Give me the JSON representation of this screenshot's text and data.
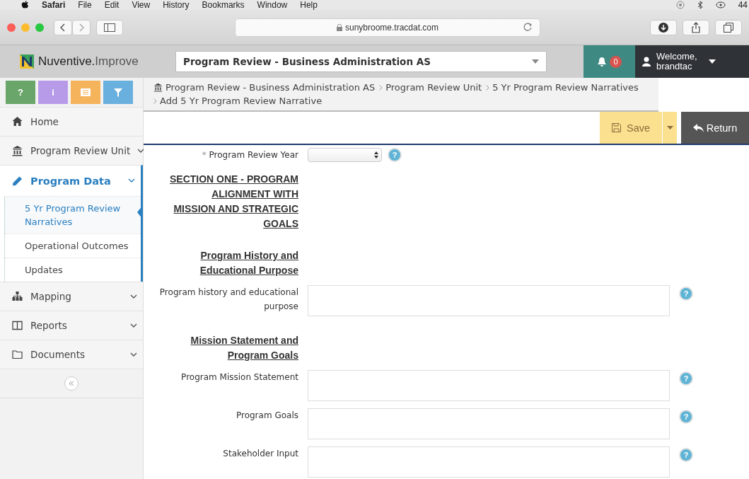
{
  "menu_bar": {
    "items": [
      "Safari",
      "File",
      "Edit",
      "View",
      "History",
      "Bookmarks",
      "Window",
      "Help"
    ],
    "battery": "44"
  },
  "browser": {
    "url": "sunybroome.tracdat.com"
  },
  "header": {
    "brand": "Nuventive",
    "brand_dot": ".",
    "product": "Improve",
    "context": "Program Review - Business Administration AS",
    "notifications": "0",
    "welcome": "Welcome,",
    "user": "brandtac"
  },
  "tools": [
    {
      "label": "?",
      "color": "#6aa56a"
    },
    {
      "label": "i",
      "color": "#b79be8"
    },
    {
      "color": "#f5b35c"
    },
    {
      "color": "#6ab0de"
    }
  ],
  "nav": [
    {
      "label": "Home",
      "expandable": false,
      "selected": false
    },
    {
      "label": "Program Review Unit",
      "expandable": true,
      "selected": false
    },
    {
      "label": "Program Data",
      "expandable": true,
      "selected": true,
      "children": [
        {
          "label": "5 Yr Program Review Narratives",
          "selected": true
        },
        {
          "label": "Operational Outcomes",
          "selected": false
        },
        {
          "label": "Updates",
          "selected": false
        }
      ]
    },
    {
      "label": "Mapping",
      "expandable": true,
      "selected": false
    },
    {
      "label": "Reports",
      "expandable": true,
      "selected": false
    },
    {
      "label": "Documents",
      "expandable": true,
      "selected": false
    }
  ],
  "breadcrumb": [
    "Program Review - Business Administration AS",
    "Program Review Unit",
    "5 Yr Program Review Narratives",
    "Add 5 Yr Program Review Narrative"
  ],
  "actions": {
    "save": "Save",
    "return": "Return"
  },
  "form": [
    {
      "kind": "select",
      "label": "Program Review Year",
      "required_mark": "*",
      "help": "?"
    },
    {
      "kind": "heading",
      "label": "SECTION ONE - PROGRAM ALIGNMENT WITH MISSION AND STRATEGIC GOALS"
    },
    {
      "kind": "heading",
      "label": "Program History and Educational Purpose"
    },
    {
      "kind": "textarea",
      "label": "Program history and educational purpose",
      "help": "?"
    },
    {
      "kind": "heading",
      "label": "Mission Statement and Program Goals"
    },
    {
      "kind": "textarea",
      "label": "Program Mission Statement",
      "help": "?"
    },
    {
      "kind": "textarea",
      "label": "Program Goals",
      "help": "?"
    },
    {
      "kind": "textarea",
      "label": "Stakeholder Input",
      "help": "?"
    }
  ]
}
